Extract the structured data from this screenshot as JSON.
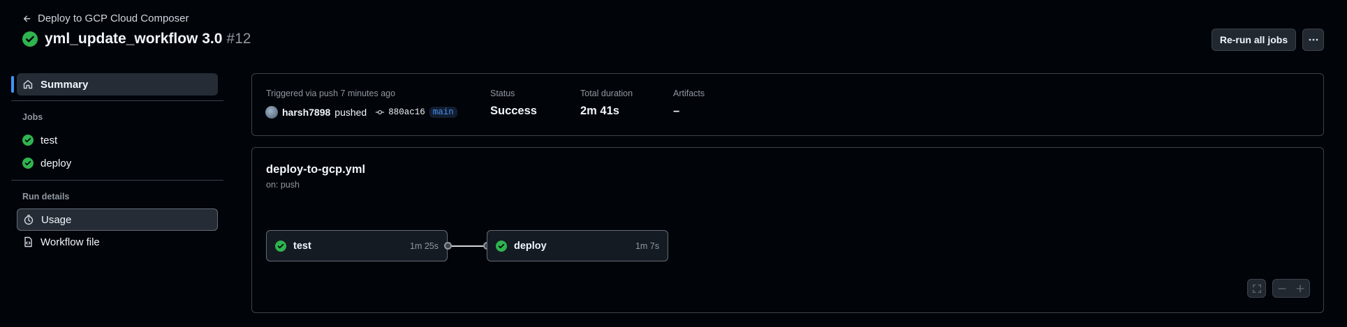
{
  "header": {
    "back_link": "Deploy to GCP Cloud Composer",
    "title": "yml_update_workflow 3.0",
    "run_number": "#12",
    "rerun_label": "Re-run all jobs"
  },
  "sidebar": {
    "summary_label": "Summary",
    "jobs_heading": "Jobs",
    "jobs": [
      {
        "label": "test",
        "status": "success"
      },
      {
        "label": "deploy",
        "status": "success"
      }
    ],
    "run_details_heading": "Run details",
    "usage_label": "Usage",
    "workflow_file_label": "Workflow file"
  },
  "summary": {
    "trigger_label": "Triggered via push 7 minutes ago",
    "user": "harsh7898",
    "action": "pushed",
    "commit": "880ac16",
    "branch": "main",
    "status_label": "Status",
    "status_value": "Success",
    "duration_label": "Total duration",
    "duration_value": "2m 41s",
    "artifacts_label": "Artifacts",
    "artifacts_value": "–"
  },
  "workflow": {
    "name": "deploy-to-gcp.yml",
    "trigger": "on: push",
    "jobs": [
      {
        "name": "test",
        "duration": "1m 25s"
      },
      {
        "name": "deploy",
        "duration": "1m 7s"
      }
    ]
  },
  "colors": {
    "success": "#2fb44f",
    "background": "#010409",
    "accent": "#4493f8"
  }
}
